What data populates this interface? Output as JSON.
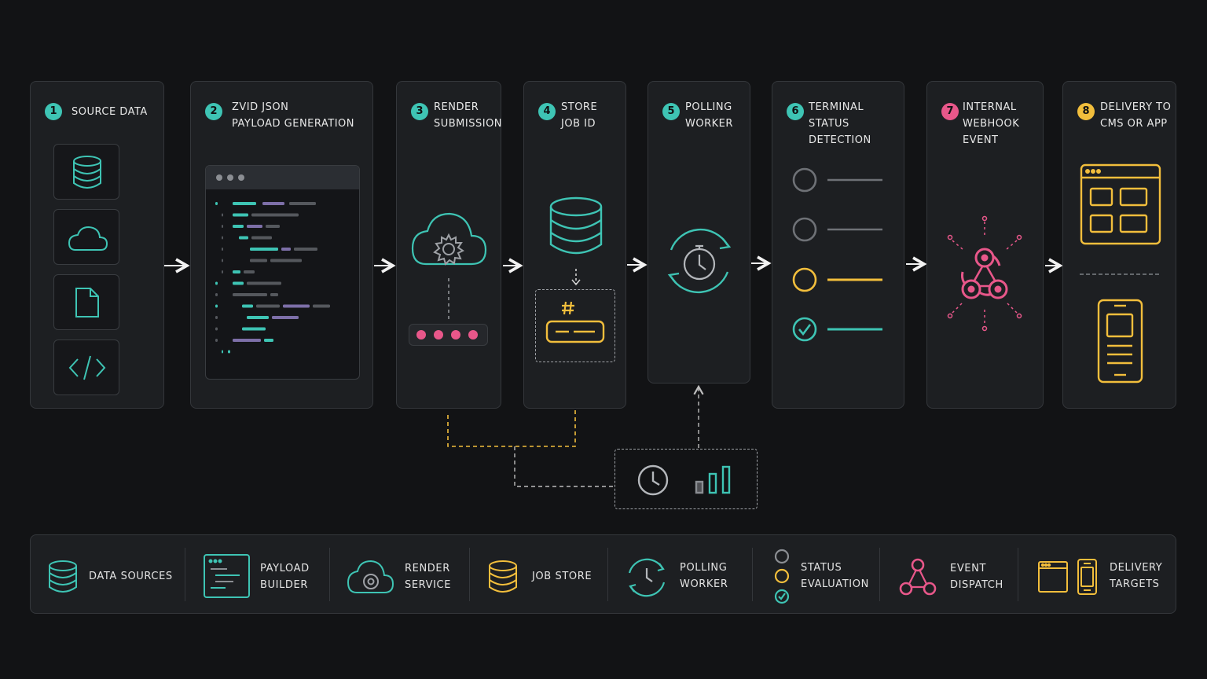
{
  "colors": {
    "teal": "#3ec4b4",
    "yellow": "#f2be3c",
    "pink": "#e8578a",
    "grey": "#8b8e93",
    "bg": "#121315",
    "panel": "#1d1f22"
  },
  "steps": [
    {
      "number": "1",
      "title": "SOURCE DATA",
      "accent": "#3ec4b4",
      "icons": [
        "database-icon",
        "cloud-icon",
        "file-icon",
        "code-icon"
      ]
    },
    {
      "number": "2",
      "title": "ZVID JSON\nPAYLOAD GENERATION",
      "accent": "#3ec4b4",
      "icons": [
        "code-editor-icon"
      ]
    },
    {
      "number": "3",
      "title": "RENDER\nSUBMISSION",
      "accent": "#3ec4b4",
      "icons": [
        "cloud-gear-icon",
        "password-dots-icon"
      ]
    },
    {
      "number": "4",
      "title": "STORE\nJOB ID",
      "accent": "#3ec4b4",
      "icons": [
        "database-icon",
        "hash-icon"
      ]
    },
    {
      "number": "5",
      "title": "POLLING\nWORKER",
      "accent": "#3ec4b4",
      "icons": [
        "stopwatch-refresh-icon"
      ]
    },
    {
      "number": "6",
      "title": "TERMINAL STATUS\nDETECTION",
      "accent": "#3ec4b4",
      "icons": [
        "status-list-icon"
      ]
    },
    {
      "number": "7",
      "title": "INTERNAL\nWEBHOOK EVENT",
      "accent": "#e8578a",
      "icons": [
        "webhook-icon"
      ]
    },
    {
      "number": "8",
      "title": "DELIVERY TO\nCMS OR APP",
      "accent": "#f2be3c",
      "icons": [
        "browser-window-icon",
        "mobile-phone-icon"
      ]
    }
  ],
  "legend": [
    {
      "label": "DATA SOURCES",
      "icon": "database-icon"
    },
    {
      "label": "PAYLOAD\nBUILDER",
      "icon": "code-editor-icon"
    },
    {
      "label": "RENDER\nSERVICE",
      "icon": "cloud-gear-icon"
    },
    {
      "label": "JOB STORE",
      "icon": "database-icon"
    },
    {
      "label": "POLLING\nWORKER",
      "icon": "clock-refresh-icon"
    },
    {
      "label": "STATUS\nEVALUATION",
      "icon": "status-circles-icon"
    },
    {
      "label": "EVENT\nDISPATCH",
      "icon": "webhook-icon"
    },
    {
      "label": "DELIVERY\nTARGETS",
      "icon": "browser-phone-icon"
    }
  ],
  "scheduler": {
    "icons": [
      "clock-icon",
      "bar-chart-icon"
    ]
  }
}
